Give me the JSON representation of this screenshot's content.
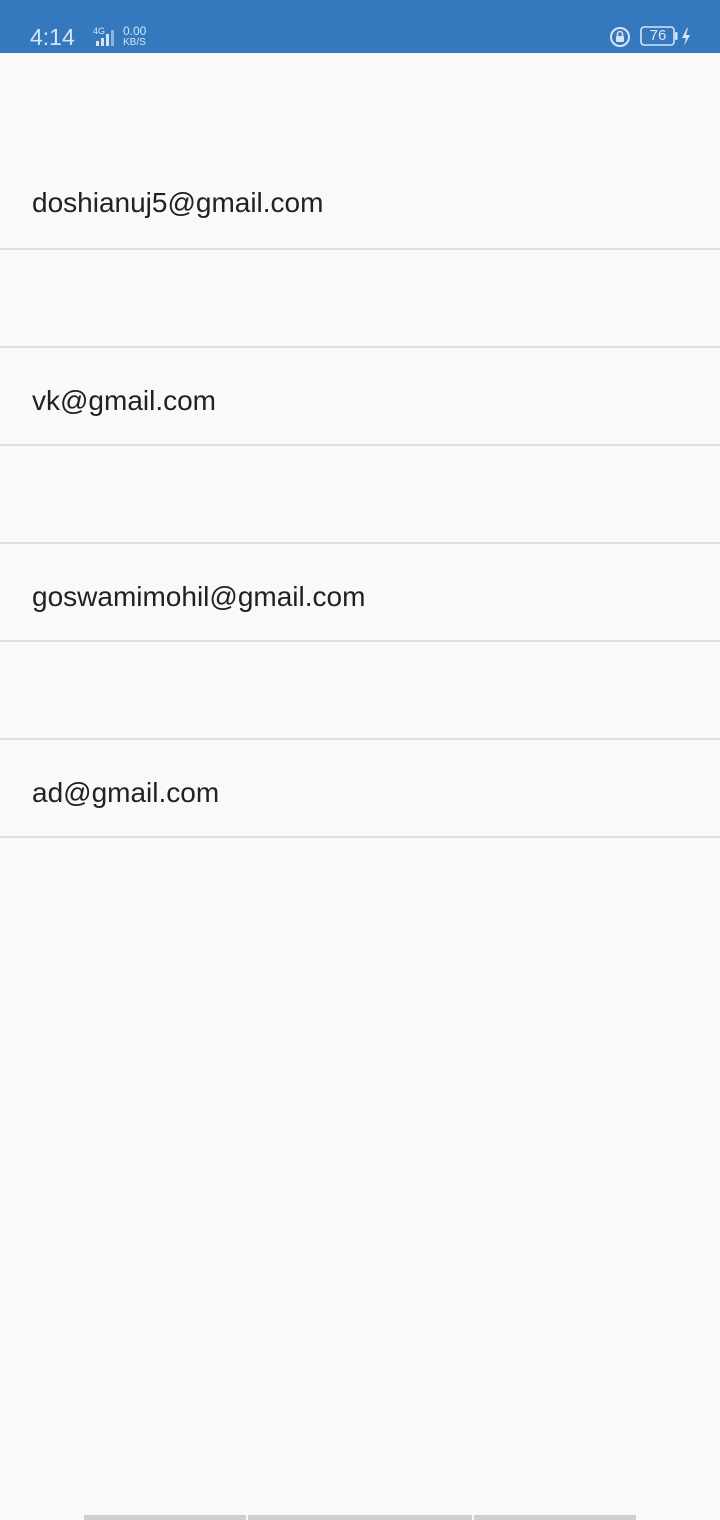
{
  "colors": {
    "accent": "#3478bd",
    "background": "#f9f9f9",
    "divider": "#dedede",
    "text": "#212121"
  },
  "status_bar": {
    "time": "4:14",
    "network": "4G",
    "data_speed_value": "0.00",
    "data_speed_unit": "KB/S",
    "battery_level": "76",
    "icons": [
      "signal-icon",
      "rotation-lock-icon",
      "battery-icon",
      "charging-icon"
    ]
  },
  "list": {
    "items": [
      {
        "email": "doshianuj5@gmail.com"
      },
      {
        "email": ""
      },
      {
        "email": "vk@gmail.com"
      },
      {
        "email": ""
      },
      {
        "email": "goswamimohil@gmail.com"
      },
      {
        "email": ""
      },
      {
        "email": "ad@gmail.com"
      }
    ]
  }
}
